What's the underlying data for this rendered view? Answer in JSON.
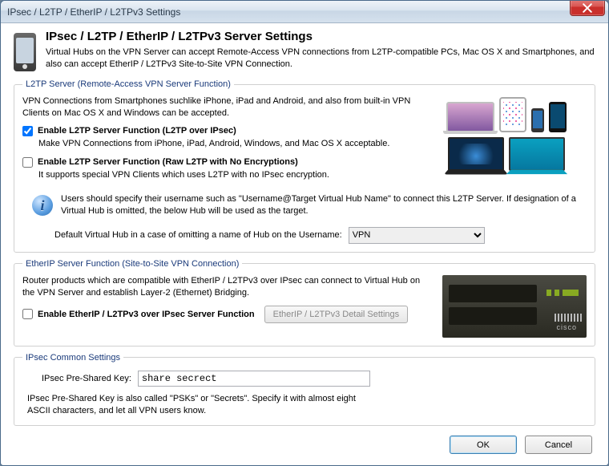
{
  "window": {
    "title": "IPsec / L2TP / EtherIP / L2TPv3 Settings"
  },
  "header": {
    "title": "IPsec / L2TP / EtherIP / L2TPv3 Server Settings",
    "desc": "Virtual Hubs on the VPN Server can accept Remote-Access VPN connections from L2TP-compatible PCs, Mac OS X and Smartphones, and also can accept EtherIP / L2TPv3 Site-to-Site VPN Connection."
  },
  "l2tp": {
    "legend": "L2TP Server (Remote-Access VPN Server Function)",
    "intro": "VPN Connections from Smartphones suchlike iPhone, iPad and Android, and also from built-in VPN Clients on Mac OS X and Windows can be accepted.",
    "cb1_label": "Enable L2TP Server Function (L2TP over IPsec)",
    "cb1_checked": true,
    "cb1_sub": "Make VPN Connections from iPhone, iPad, Android, Windows, and Mac OS X acceptable.",
    "cb2_label": "Enable L2TP Server Function (Raw L2TP with No Encryptions)",
    "cb2_checked": false,
    "cb2_sub": "It supports special VPN Clients which uses L2TP with no IPsec encryption.",
    "info_text": "Users should specify their username such as \"Username@Target Virtual Hub Name\" to connect this L2TP Server. If designation of a Virtual Hub is omitted, the below Hub will be used as the target.",
    "hub_label": "Default Virtual Hub in a case of omitting a name of Hub on the Username:",
    "hub_value": "VPN"
  },
  "ether": {
    "legend": "EtherIP Server Function (Site-to-Site VPN Connection)",
    "intro": "Router products which are compatible with EtherIP / L2TPv3 over IPsec can connect to Virtual Hub on the VPN Server and establish Layer-2 (Ethernet) Bridging.",
    "cb_label": "Enable EtherIP / L2TPv3 over IPsec Server Function",
    "cb_checked": false,
    "detail_btn": "EtherIP / L2TPv3 Detail Settings",
    "device_label": "cisco"
  },
  "ipsec": {
    "legend": "IPsec Common Settings",
    "psk_label": "IPsec Pre-Shared Key:",
    "psk_value": "share secrect",
    "psk_note": "IPsec Pre-Shared Key is also called \"PSKs\" or \"Secrets\". Specify it with almost eight ASCII characters, and let all VPN users know."
  },
  "buttons": {
    "ok": "OK",
    "cancel": "Cancel"
  }
}
